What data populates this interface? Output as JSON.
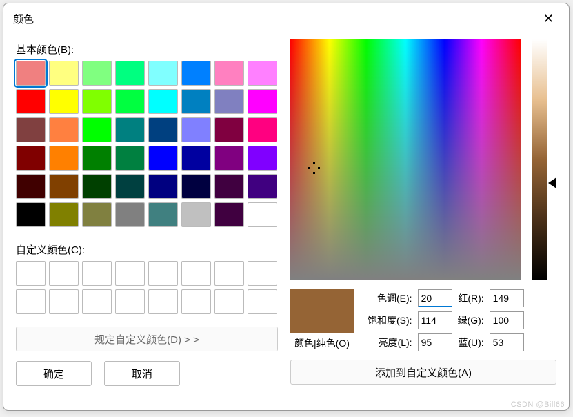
{
  "title": "颜色",
  "labels": {
    "basic_colors": "基本颜色(B):",
    "custom_colors": "自定义颜色(C):",
    "define_custom": "规定自定义颜色(D) > >",
    "ok": "确定",
    "cancel": "取消",
    "preview": "颜色|纯色(O)",
    "hue": "色调(E):",
    "sat": "饱和度(S):",
    "lum": "亮度(L):",
    "red": "红(R):",
    "green": "绿(G):",
    "blue": "蓝(U):",
    "add": "添加到自定义颜色(A)"
  },
  "values": {
    "hue": "20",
    "sat": "114",
    "lum": "95",
    "red": "149",
    "green": "100",
    "blue": "53"
  },
  "selected_color": "#956435",
  "basic_colors": [
    "#f08080",
    "#ffff80",
    "#80ff80",
    "#00ff80",
    "#80ffff",
    "#0080ff",
    "#ff80c0",
    "#ff80ff",
    "#ff0000",
    "#ffff00",
    "#80ff00",
    "#00ff40",
    "#00ffff",
    "#0080c0",
    "#8080c0",
    "#ff00ff",
    "#804040",
    "#ff8040",
    "#00ff00",
    "#008080",
    "#004080",
    "#8080ff",
    "#800040",
    "#ff0080",
    "#800000",
    "#ff8000",
    "#008000",
    "#008040",
    "#0000ff",
    "#0000a0",
    "#800080",
    "#8000ff",
    "#400000",
    "#804000",
    "#004000",
    "#004040",
    "#000080",
    "#000040",
    "#400040",
    "#400080",
    "#000000",
    "#808000",
    "#808040",
    "#808080",
    "#408080",
    "#c0c0c0",
    "#400040",
    "#ffffff"
  ],
  "custom_slots": 16,
  "watermark": "CSDN @Bill66"
}
